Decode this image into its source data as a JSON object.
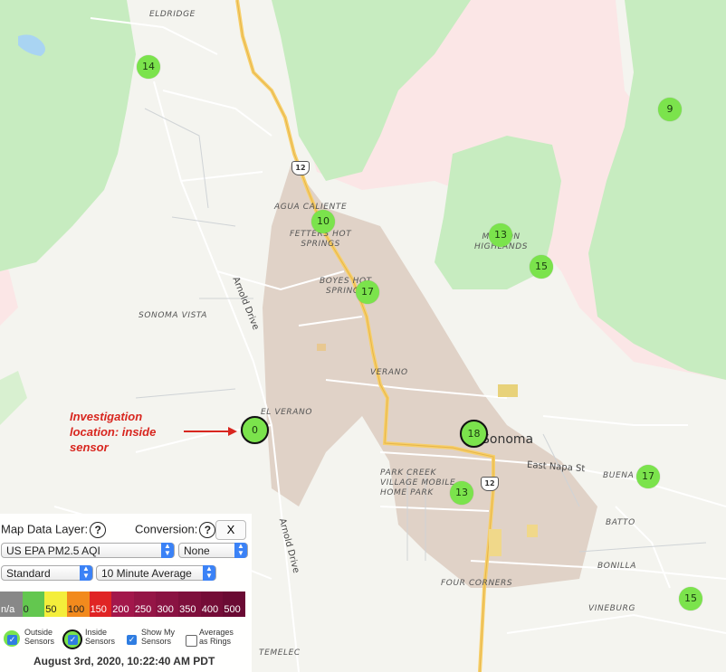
{
  "places": {
    "eldridge": "ELDRIDGE",
    "agua_caliente": "AGUA CALIENTE",
    "fetters_hot_springs": "FETTERS HOT\nSPRINGS",
    "boyes_hot_springs": "BOYES HOT\nSPRINGS",
    "sonoma_vista": "SONOMA VISTA",
    "verano": "VERANO",
    "el_verano": "EL VERANO",
    "mission_highlands": "MISSION\nHIGHLANDS",
    "sonoma": "Sonoma",
    "park_creek": "PARK CREEK\nVILLAGE MOBILE\nHOME PARK",
    "buena": "BUENA",
    "batto": "BATTO",
    "bonilla": "BONILLA",
    "four_corners": "FOUR CORNERS",
    "vineburg": "VINEBURG",
    "temelec": "TEMELEC"
  },
  "streets": {
    "arnold_drive_1": "Arnold Drive",
    "arnold_drive_2": "Arnold Drive",
    "east_napa": "East Napa St"
  },
  "route_shields": [
    "12",
    "12"
  ],
  "sensors": [
    {
      "value": "14",
      "type": "outside"
    },
    {
      "value": "9",
      "type": "outside"
    },
    {
      "value": "10",
      "type": "outside"
    },
    {
      "value": "13",
      "type": "outside"
    },
    {
      "value": "15",
      "type": "outside"
    },
    {
      "value": "17",
      "type": "outside"
    },
    {
      "value": "0",
      "type": "inside"
    },
    {
      "value": "18",
      "type": "inside"
    },
    {
      "value": "13",
      "type": "outside"
    },
    {
      "value": "17",
      "type": "outside"
    },
    {
      "value": "15",
      "type": "outside"
    }
  ],
  "annotation": {
    "line1": "Investigation",
    "line2": "location: inside",
    "line3": "sensor",
    "color": "#d8261f"
  },
  "panel": {
    "map_data_layer_label": "Map Data Layer:",
    "conversion_label": "Conversion:",
    "help_glyph": "?",
    "close_label": "X",
    "layer_select": "US EPA PM2.5 AQI",
    "conversion_select": "None",
    "mode_select": "Standard",
    "average_select": "10 Minute Average",
    "scale": [
      {
        "label": "n/a",
        "color": "#888888"
      },
      {
        "label": "0",
        "color": "#63c74f"
      },
      {
        "label": "50",
        "color": "#f4ee3b"
      },
      {
        "label": "100",
        "color": "#f28a1d"
      },
      {
        "label": "150",
        "color": "#e02424"
      },
      {
        "label": "200",
        "color": "#a3174b"
      },
      {
        "label": "250",
        "color": "#951546"
      },
      {
        "label": "300",
        "color": "#8a1242"
      },
      {
        "label": "350",
        "color": "#7e0f3c"
      },
      {
        "label": "400",
        "color": "#740c37"
      },
      {
        "label": "500",
        "color": "#6a0a33"
      }
    ],
    "options": {
      "outside": "Outside\nSensors",
      "inside": "Inside\nSensors",
      "show_my": "Show My\nSensors",
      "averages": "Averages\nas Rings"
    },
    "date": "August 3rd, 2020, 10:22:40 AM PDT"
  },
  "colors": {
    "sensor_green": "#7be34c",
    "forest": "#c7ecc0",
    "pink": "#fbe6e6",
    "town_shade": "#dccbc0",
    "highway": "#f7cf6a"
  }
}
